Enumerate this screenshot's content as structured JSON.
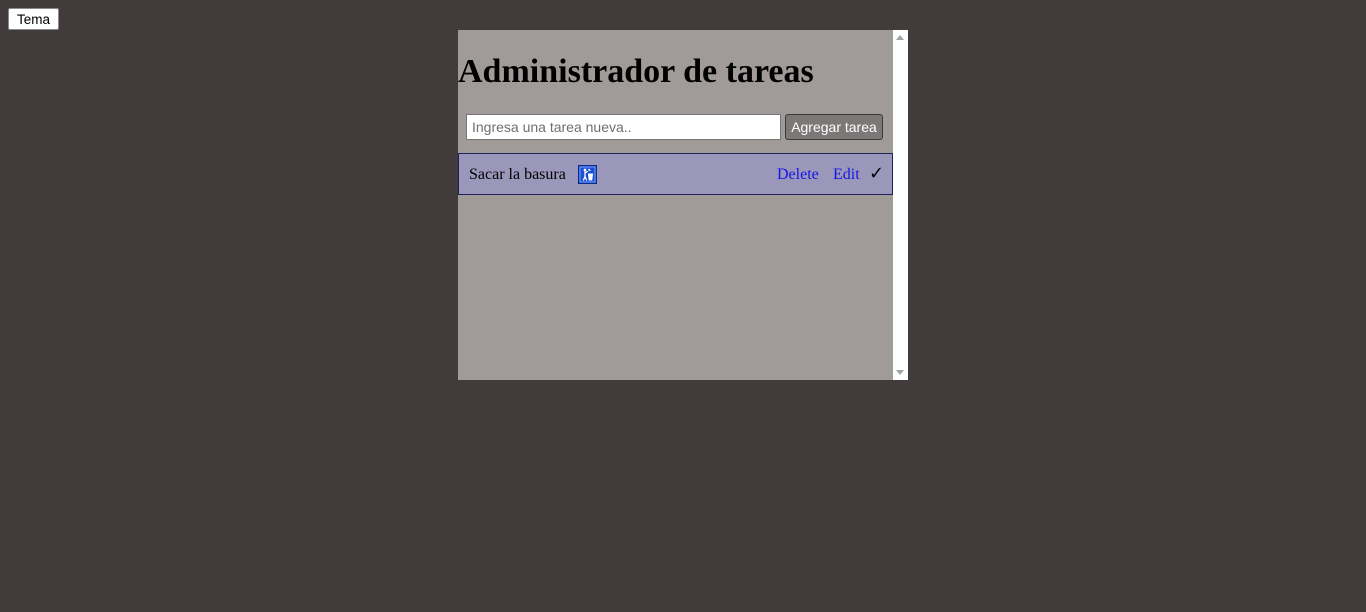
{
  "theme_button": {
    "label": "Tema"
  },
  "app": {
    "title": "Administrador de tareas",
    "input": {
      "placeholder": "Ingresa una tarea nueva..",
      "value": ""
    },
    "add_button": {
      "label": "Agregar tarea"
    },
    "tasks": [
      {
        "text": "Sacar la basura",
        "icon": "trash-disposal-icon",
        "delete_label": "Delete",
        "edit_label": "Edit",
        "complete_mark": "✓"
      }
    ]
  },
  "colors": {
    "page_background": "#413c3b",
    "panel_background": "#a09a99",
    "task_row_background": "#9b97bb",
    "task_row_border": "#1f1f5a",
    "link": "#1414e6",
    "add_button_background": "#7d7878",
    "icon_background": "#1a4fd6"
  }
}
